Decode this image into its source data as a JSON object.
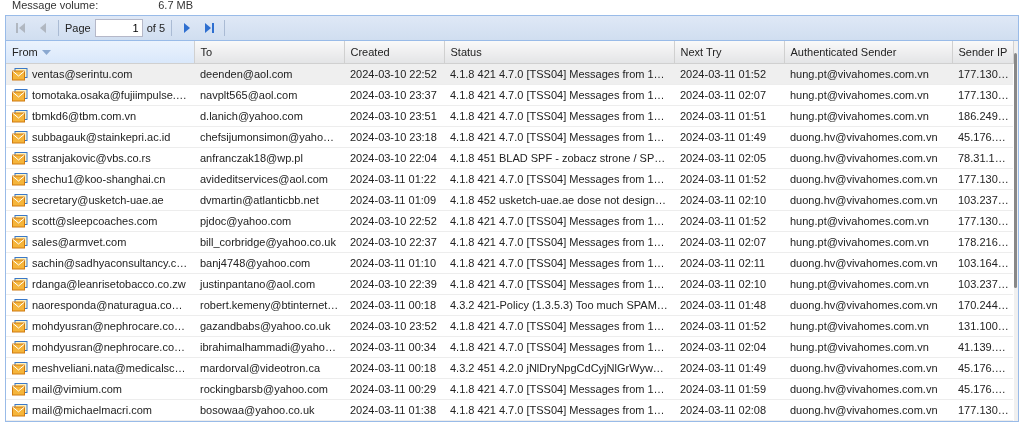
{
  "summary": {
    "label": "Message volume:",
    "value": "6.7 MB"
  },
  "pager": {
    "first_disabled": true,
    "prev_disabled": true,
    "next_disabled": false,
    "last_disabled": false,
    "page_label": "Page",
    "page": "1",
    "of_label": "of 5"
  },
  "table": {
    "columns": [
      {
        "label": "From",
        "sorted": true
      },
      {
        "label": "To",
        "sorted": false
      },
      {
        "label": "Created",
        "sorted": false
      },
      {
        "label": "Status",
        "sorted": false
      },
      {
        "label": "Next Try",
        "sorted": false
      },
      {
        "label": "Authenticated Sender",
        "sorted": false
      },
      {
        "label": "Sender IP",
        "sorted": false
      }
    ],
    "rows": [
      {
        "selected": true,
        "cells": [
          "ventas@serintu.com",
          "deenden@aol.com",
          "2024-03-10 22:52",
          "4.1.8 421 4.7.0 [TSS04] Messages from 1…",
          "2024-03-11 01:52",
          "hung.pt@vivahomes.com.vn",
          "177.130…"
        ]
      },
      {
        "selected": false,
        "cells": [
          "tomotaka.osaka@fujiimpulse.…",
          "navplt565@aol.com",
          "2024-03-10 23:37",
          "4.1.8 421 4.7.0 [TSS04] Messages from 1…",
          "2024-03-11 02:07",
          "hung.pt@vivahomes.com.vn",
          "177.130…"
        ]
      },
      {
        "selected": false,
        "cells": [
          "tbmkd6@tbm.com.vn",
          "d.lanich@yahoo.com",
          "2024-03-10 23:51",
          "4.1.8 421 4.7.0 [TSS04] Messages from 1…",
          "2024-03-11 01:51",
          "hung.pt@vivahomes.com.vn",
          "186.249…"
        ]
      },
      {
        "selected": false,
        "cells": [
          "subbagauk@stainkepri.ac.id",
          "chefsijumonsimon@yaho…",
          "2024-03-10 23:18",
          "4.1.8 421 4.7.0 [TSS04] Messages from 1…",
          "2024-03-11 01:49",
          "duong.hv@vivahomes.com.vn",
          "45.176.…"
        ]
      },
      {
        "selected": false,
        "cells": [
          "sstranjakovic@vbs.co.rs",
          "anfranczak18@wp.pl",
          "2024-03-10 22:04",
          "4.1.8 451 BLAD SPF - zobacz strone / SP…",
          "2024-03-11 02:05",
          "duong.hv@vivahomes.com.vn",
          "78.31.1…"
        ]
      },
      {
        "selected": false,
        "cells": [
          "shechu1@koo-shanghai.cn",
          "avideditservices@aol.com",
          "2024-03-11 01:22",
          "4.1.8 421 4.7.0 [TSS04] Messages from 1…",
          "2024-03-11 01:52",
          "duong.hv@vivahomes.com.vn",
          "177.130…"
        ]
      },
      {
        "selected": false,
        "cells": [
          "secretary@usketch-uae.ae",
          "dvmartin@atlanticbb.net",
          "2024-03-11 01:09",
          "4.1.8 452 usketch-uae.ae dose not design…",
          "2024-03-11 02:10",
          "duong.hv@vivahomes.com.vn",
          "103.237…"
        ]
      },
      {
        "selected": false,
        "cells": [
          "scott@sleepcoaches.com",
          "pjdoc@yahoo.com",
          "2024-03-10 22:52",
          "4.1.8 421 4.7.0 [TSS04] Messages from 1…",
          "2024-03-11 01:52",
          "hung.pt@vivahomes.com.vn",
          "177.130…"
        ]
      },
      {
        "selected": false,
        "cells": [
          "sales@armvet.com",
          "bill_corbridge@yahoo.co.uk",
          "2024-03-10 22:37",
          "4.1.8 421 4.7.0 [TSS04] Messages from 1…",
          "2024-03-11 02:07",
          "hung.pt@vivahomes.com.vn",
          "178.216…"
        ]
      },
      {
        "selected": false,
        "cells": [
          "sachin@sadhyaconsultancy.c…",
          "banj4748@yahoo.com",
          "2024-03-11 01:10",
          "4.1.8 421 4.7.0 [TSS04] Messages from 1…",
          "2024-03-11 02:11",
          "duong.hv@vivahomes.com.vn",
          "103.164…"
        ]
      },
      {
        "selected": false,
        "cells": [
          "rdanga@leanrisetobacco.co.zw",
          "justinpantano@aol.com",
          "2024-03-10 22:39",
          "4.1.8 421 4.7.0 [TSS04] Messages from 1…",
          "2024-03-11 02:10",
          "hung.pt@vivahomes.com.vn",
          "103.237…"
        ]
      },
      {
        "selected": false,
        "cells": [
          "naoresponda@naturagua.co…",
          "robert.kemeny@btinternet…",
          "2024-03-11 00:18",
          "4.3.2 421-Policy (1.3.5.3) Too much SPAM…",
          "2024-03-11 01:48",
          "duong.hv@vivahomes.com.vn",
          "170.244…"
        ]
      },
      {
        "selected": false,
        "cells": [
          "mohdyusran@nephrocare.co…",
          "gazandbabs@yahoo.co.uk",
          "2024-03-10 23:52",
          "4.1.8 421 4.7.0 [TSS04] Messages from 1…",
          "2024-03-11 01:52",
          "hung.pt@vivahomes.com.vn",
          "131.100…"
        ]
      },
      {
        "selected": false,
        "cells": [
          "mohdyusran@nephrocare.co…",
          "ibrahimalhammadi@yaho…",
          "2024-03-11 00:34",
          "4.1.8 421 4.7.0 [TSS04] Messages from 1…",
          "2024-03-11 02:04",
          "hung.pt@vivahomes.com.vn",
          "41.139.…"
        ]
      },
      {
        "selected": false,
        "cells": [
          "meshveliani.nata@medicalsc…",
          "mardorval@videotron.ca",
          "2024-03-11 00:18",
          "4.3.2 451 4.2.0 jNlDryNpgCdCyjNlGrWyw…",
          "2024-03-11 01:49",
          "duong.hv@vivahomes.com.vn",
          "45.176.…"
        ]
      },
      {
        "selected": false,
        "cells": [
          "mail@vimium.com",
          "rockingbarsb@yahoo.com",
          "2024-03-11 00:29",
          "4.1.8 421 4.7.0 [TSS04] Messages from 1…",
          "2024-03-11 01:59",
          "duong.hv@vivahomes.com.vn",
          "45.176.…"
        ]
      },
      {
        "selected": false,
        "cells": [
          "mail@michaelmacri.com",
          "bosowaa@yahoo.co.uk",
          "2024-03-11 01:38",
          "4.1.8 421 4.7.0 [TSS04] Messages from 1…",
          "2024-03-11 02:08",
          "duong.hv@vivahomes.com.vn",
          "177.130…"
        ]
      }
    ]
  }
}
